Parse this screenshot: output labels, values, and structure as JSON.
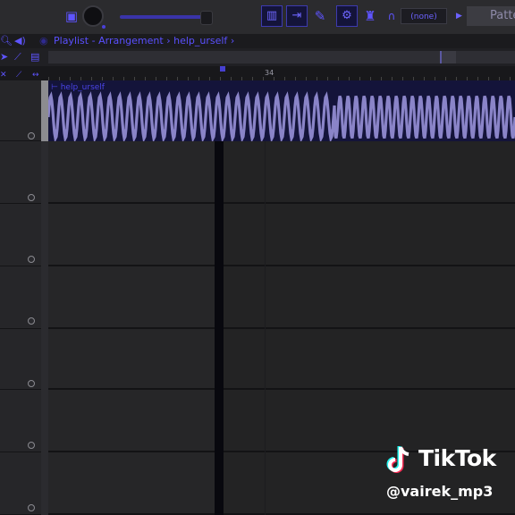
{
  "toolbar": {
    "pattern_label": "Patter",
    "pattern_value": "(none)"
  },
  "playlist": {
    "title": "Playlist",
    "separator": "-",
    "view": "Arrangement",
    "crumb_sep": "›",
    "clip_name": "help_urself",
    "ruler_bar": "34"
  },
  "tracks": [
    {
      "id": "track-1"
    },
    {
      "id": "track-2"
    },
    {
      "id": "track-3"
    },
    {
      "id": "track-4"
    },
    {
      "id": "track-5"
    },
    {
      "id": "track-6"
    },
    {
      "id": "track-7"
    }
  ],
  "watermark": {
    "brand": "TikTok",
    "handle": "@vairek_mp3"
  },
  "colors": {
    "accent": "#5a50ff",
    "waveform": "#8a84c8",
    "clip_bg": "#14143a",
    "lane_bg": "#262628"
  }
}
